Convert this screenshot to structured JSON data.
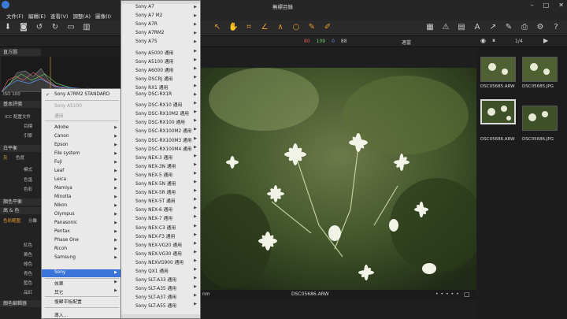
{
  "window": {
    "title": "無標目錄"
  },
  "menubar": [
    "文件(F)",
    "編輯(E)",
    "查看(V)",
    "調整(A)",
    "圖像(I)"
  ],
  "toolbar": {
    "right_label": "適當",
    "page": "1/4"
  },
  "readouts": {
    "r": "80",
    "g": "109",
    "b": "0",
    "v": "88"
  },
  "left": {
    "histogram_label": "直方圖",
    "iso": "ISO 100",
    "basic_label": "基本評價",
    "icc_label": "ICC 配置文件",
    "target_label": "目標",
    "engine_label": "引擎",
    "wb_label": "白平衡",
    "wb_tabs": [
      "灰",
      "色度"
    ],
    "mode_label": "模式",
    "temp_label": "色溫",
    "tint_label": "色彩",
    "tone_label": "顏色平衡",
    "hsl_label": "高 & 色",
    "hsl_tabs": [
      "色彩範圍",
      "分離"
    ],
    "colors": [
      "紅色",
      "黃色",
      "綠色",
      "青色",
      "藍色",
      "品紅"
    ],
    "editor_label": "顏色編輯器"
  },
  "dropdown1": {
    "items": [
      {
        "label": "Sony A7RM2 STANDARD",
        "checked": true
      },
      {
        "label": "Sony A5100",
        "disabled": true
      },
      {
        "label": "通用",
        "disabled": true
      },
      {
        "label": "Adobe",
        "sub": true
      },
      {
        "label": "Canon",
        "sub": true
      },
      {
        "label": "Epson",
        "sub": true
      },
      {
        "label": "File system",
        "sub": true
      },
      {
        "label": "Fuji",
        "sub": true
      },
      {
        "label": "Leaf",
        "sub": true
      },
      {
        "label": "Leica",
        "sub": true
      },
      {
        "label": "Mamiya",
        "sub": true
      },
      {
        "label": "Minolta",
        "sub": true
      },
      {
        "label": "Nikon",
        "sub": true
      },
      {
        "label": "Olympus",
        "sub": true
      },
      {
        "label": "Panasonic",
        "sub": true
      },
      {
        "label": "Pentax",
        "sub": true
      },
      {
        "label": "Phase One",
        "sub": true
      },
      {
        "label": "Ricoh",
        "sub": true
      },
      {
        "label": "Samsung",
        "sub": true
      },
      {
        "label": "Sony",
        "sub": true,
        "selected": true
      },
      {
        "label": "效果",
        "sub": true
      },
      {
        "label": "其它",
        "sub": true
      },
      {
        "label": "復歸平板配置"
      },
      {
        "label": "導入..."
      }
    ]
  },
  "dropdown2": {
    "items": [
      "Sony A7",
      "Sony A7 M2",
      "Sony A7R",
      "Sony A7RM2",
      "Sony A7S",
      "Sony A5000 通用",
      "Sony A5100 通用",
      "Sony A6000 通用",
      "Sony DSCRJ 通用",
      "Sony RX1 通用",
      "Sony DSC-RX1R",
      "Sony DSC-RX10 通用",
      "Sony DSC-RX10M2 通用",
      "Sony DSC-RX100 通用",
      "Sony DSC-RX100M2 通用",
      "Sony DSC-RX100M3 通用",
      "Sony DSC-RX100M4 通用",
      "Sony NEX-3 通用",
      "Sony NEX-3N 通用",
      "Sony NEX-5 通用",
      "Sony NEX-5N 通用",
      "Sony NEX-5R 通用",
      "Sony NEX-5T 通用",
      "Sony NEX-6 通用",
      "Sony NEX-7 通用",
      "Sony NEX-C3 通用",
      "Sony NEX-F3 通用",
      "Sony NEX-VG20 通用",
      "Sony NEX-VG30 通用",
      "Sony NEXVG900 通用",
      "Sony QX1 通用",
      "Sony SLT-A33 通用",
      "Sony SLT-A35 通用",
      "Sony SLT-A37 通用",
      "Sony SLT-A55 通用"
    ]
  },
  "viewer": {
    "filename": "DSC05686.ARW",
    "left_clip": "nm"
  },
  "thumbnails": [
    {
      "name": "DSC05685.ARW"
    },
    {
      "name": "DSC05685.JPG"
    },
    {
      "name": "DSC05686.ARW",
      "selected": true
    },
    {
      "name": "DSC05686.JPG"
    }
  ],
  "colors": {
    "accent": "#3b74d8",
    "tool_orange": "#e79a2f"
  }
}
